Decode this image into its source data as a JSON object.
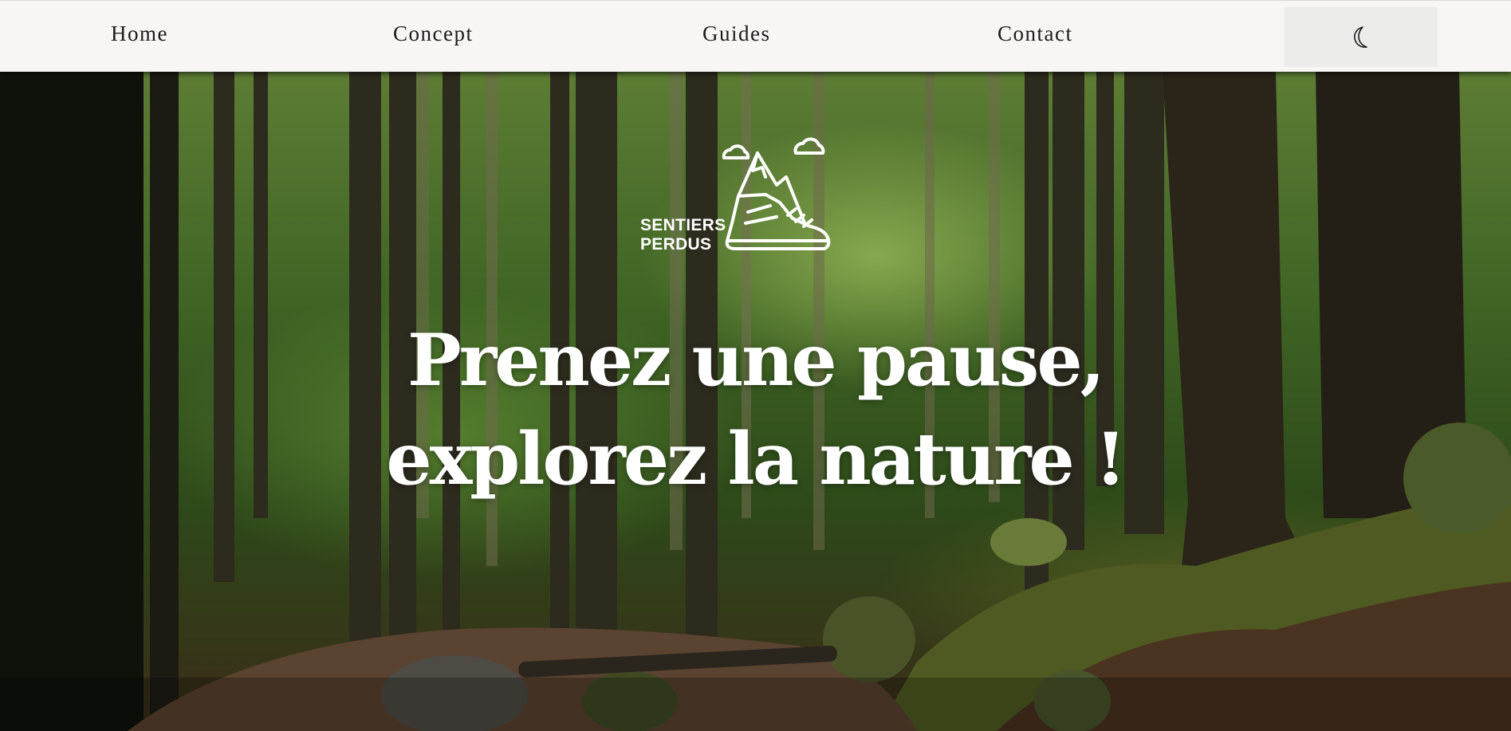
{
  "nav": {
    "links": [
      {
        "label": "Home"
      },
      {
        "label": "Concept"
      },
      {
        "label": "Guides"
      },
      {
        "label": "Contact"
      }
    ],
    "theme_toggle_icon": "moon-icon"
  },
  "hero": {
    "logo": {
      "line1": "SENTIERS",
      "line2": "PERDUS",
      "icon": "hiking-boot-mountain-icon"
    },
    "headline": "Prenez une pause, explorez la nature !",
    "background": "forest-photo"
  },
  "colors": {
    "nav_bg": "#f7f6f4",
    "nav_text": "#1b1b1b",
    "toggle_bg": "#ececeb",
    "headline": "#ffffff"
  }
}
